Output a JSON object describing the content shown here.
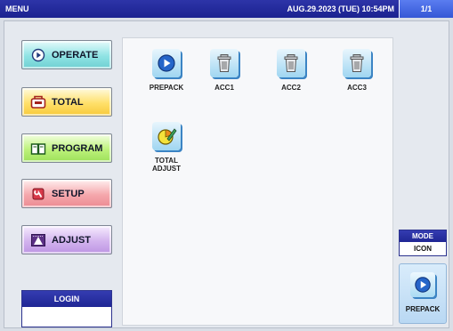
{
  "topbar": {
    "title": "MENU",
    "datetime": "AUG.29.2023 (TUE) 10:54PM",
    "page": "1/1"
  },
  "nav": {
    "operate": "OPERATE",
    "total": "TOTAL",
    "program": "PROGRAM",
    "setup": "SETUP",
    "adjust": "ADJUST"
  },
  "login": {
    "label": "LOGIN",
    "value": ""
  },
  "tiles": [
    {
      "label": "PREPACK",
      "icon": "play-icon"
    },
    {
      "label": "ACC1",
      "icon": "trash-can-icon"
    },
    {
      "label": "ACC2",
      "icon": "trash-can-icon"
    },
    {
      "label": "ACC3",
      "icon": "trash-can-icon"
    },
    {
      "label": "TOTAL\nADJUST",
      "icon": "pie-chart-pencil-icon"
    }
  ],
  "mode": {
    "label": "MODE",
    "value": "ICON"
  },
  "shortcut": {
    "label": "PREPACK",
    "icon": "play-icon"
  },
  "colors": {
    "header_blue": "#1f2694",
    "operate": "#8fe3e4",
    "total": "#ffe06a",
    "program": "#bdf27b",
    "setup": "#f5a7ac",
    "adjust": "#d3b3ee"
  }
}
